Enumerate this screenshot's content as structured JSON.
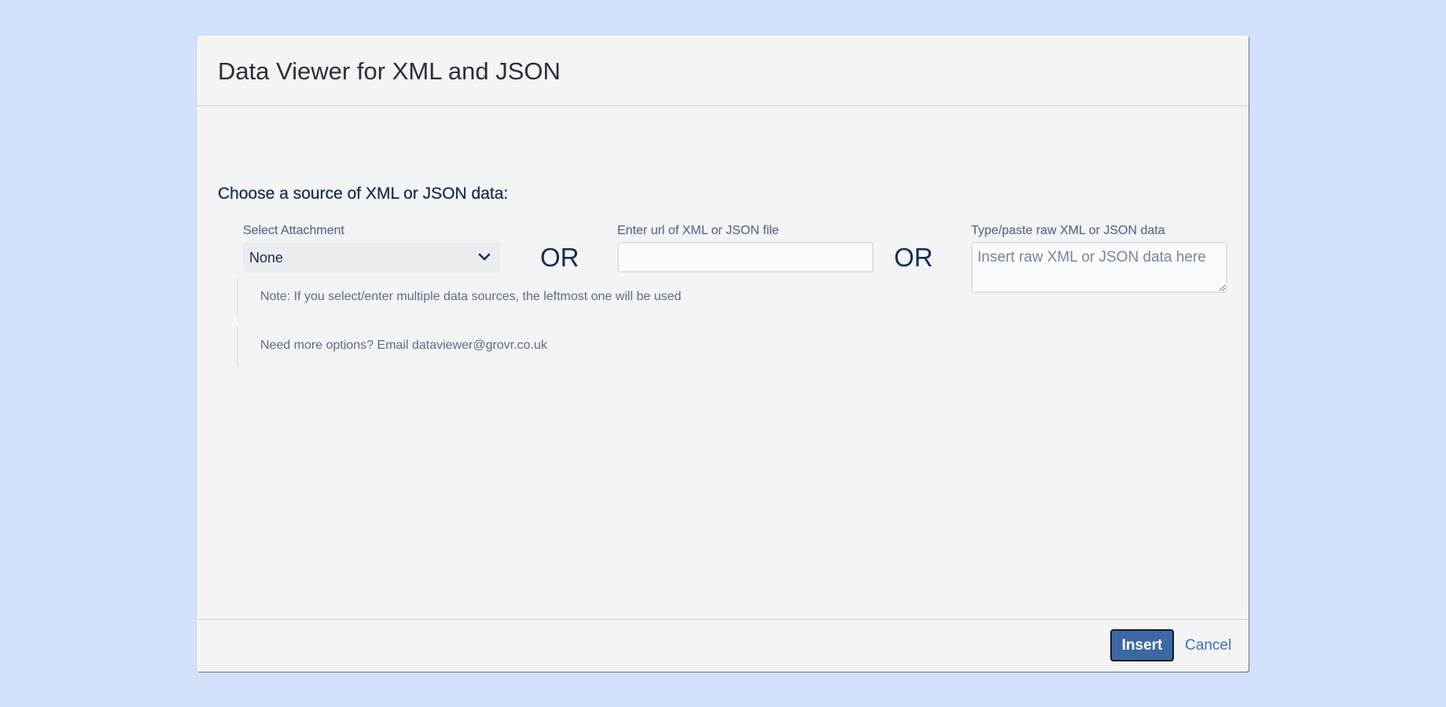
{
  "dialog": {
    "title": "Data Viewer for XML and JSON"
  },
  "form": {
    "heading": "Choose a source of XML or JSON data:",
    "attachment": {
      "label": "Select Attachment",
      "selected": "None"
    },
    "separator": "OR",
    "url": {
      "label": "Enter url of XML or JSON file",
      "value": "",
      "placeholder": ""
    },
    "raw": {
      "label": "Type/paste raw XML or JSON data",
      "value": "",
      "placeholder": "Insert raw XML or JSON data here"
    }
  },
  "notes": [
    "Note: If you select/enter multiple data sources, the leftmost one will be used",
    "Need more options? Email dataviewer@grovr.co.uk"
  ],
  "footer": {
    "insert_label": "Insert",
    "cancel_label": "Cancel"
  },
  "colors": {
    "page_background": "#d3e1fd",
    "primary_button": "#3e68a4",
    "link": "#3f6fb6",
    "text_primary": "#172b4d",
    "text_secondary": "#5e6c84"
  },
  "icons": {
    "select_dropdown": "chevron-down-icon"
  }
}
